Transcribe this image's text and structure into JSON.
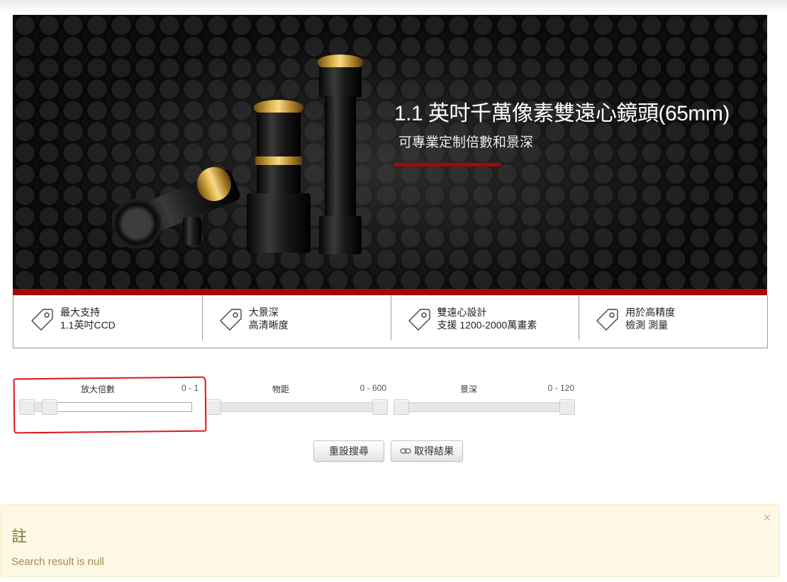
{
  "banner": {
    "title": "1.1 英吋千萬像素雙遠心鏡頭(65mm)",
    "subtitle": "可專業定制倍數和景深",
    "accent_color": "#a4080d"
  },
  "features": [
    {
      "icon": "tag-icon",
      "line1": "最大支持",
      "line2": "1.1英吋CCD"
    },
    {
      "icon": "tag-icon",
      "line1": "大景深",
      "line2": "高清晰度"
    },
    {
      "icon": "tag-icon",
      "line1": "雙遠心設計",
      "line2": "支援 1200-2000萬畫素"
    },
    {
      "icon": "tag-icon",
      "line1": "用於高精度",
      "line2": "檢測 測量"
    }
  ],
  "sliders": [
    {
      "label": "放大倍數",
      "range": "0 - 1"
    },
    {
      "label": "物距",
      "range": "0 - 600"
    },
    {
      "label": "景深",
      "range": "0 - 120"
    }
  ],
  "buttons": {
    "reset": "重設搜尋",
    "get_results": "取得結果",
    "get_results_icon": "link-icon"
  },
  "note": {
    "title": "註",
    "message": "Search result is null",
    "close": "×"
  }
}
